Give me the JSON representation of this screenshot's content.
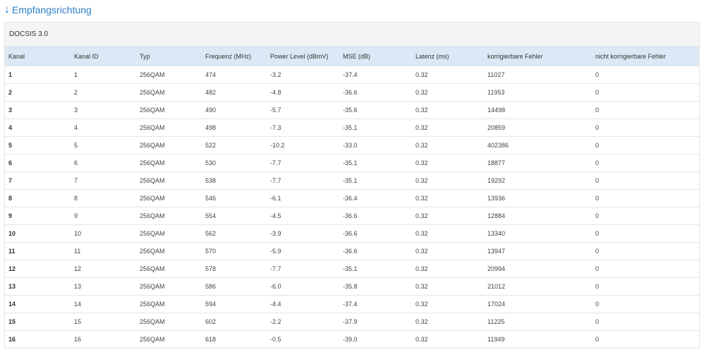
{
  "section": {
    "arrow": "↓",
    "title": "Empfangsrichtung"
  },
  "panel": {
    "title": "DOCSIS 3.0"
  },
  "table": {
    "headers": [
      "Kanal",
      "Kanal ID",
      "Typ",
      "Frequenz (MHz)",
      "Power Level (dBmV)",
      "MSE (dB)",
      "Latenz (ms)",
      "korrigierbare Fehler",
      "nicht korrigierbare Fehler"
    ],
    "rows": [
      [
        "1",
        "1",
        "256QAM",
        "474",
        "-3.2",
        "-37.4",
        "0.32",
        "11027",
        "0"
      ],
      [
        "2",
        "2",
        "256QAM",
        "482",
        "-4.8",
        "-36.6",
        "0.32",
        "11953",
        "0"
      ],
      [
        "3",
        "3",
        "256QAM",
        "490",
        "-5.7",
        "-35.6",
        "0.32",
        "14498",
        "0"
      ],
      [
        "4",
        "4",
        "256QAM",
        "498",
        "-7.3",
        "-35.1",
        "0.32",
        "20859",
        "0"
      ],
      [
        "5",
        "5",
        "256QAM",
        "522",
        "-10.2",
        "-33.0",
        "0.32",
        "402386",
        "0"
      ],
      [
        "6",
        "6",
        "256QAM",
        "530",
        "-7.7",
        "-35.1",
        "0.32",
        "18877",
        "0"
      ],
      [
        "7",
        "7",
        "256QAM",
        "538",
        "-7.7",
        "-35.1",
        "0.32",
        "19292",
        "0"
      ],
      [
        "8",
        "8",
        "256QAM",
        "546",
        "-6.1",
        "-36.4",
        "0.32",
        "13936",
        "0"
      ],
      [
        "9",
        "9",
        "256QAM",
        "554",
        "-4.5",
        "-36.6",
        "0.32",
        "12884",
        "0"
      ],
      [
        "10",
        "10",
        "256QAM",
        "562",
        "-3.9",
        "-36.6",
        "0.32",
        "13340",
        "0"
      ],
      [
        "11",
        "11",
        "256QAM",
        "570",
        "-5.9",
        "-36.6",
        "0.32",
        "13947",
        "0"
      ],
      [
        "12",
        "12",
        "256QAM",
        "578",
        "-7.7",
        "-35.1",
        "0.32",
        "20994",
        "0"
      ],
      [
        "13",
        "13",
        "256QAM",
        "586",
        "-6.0",
        "-35.8",
        "0.32",
        "21012",
        "0"
      ],
      [
        "14",
        "14",
        "256QAM",
        "594",
        "-4.4",
        "-37.4",
        "0.32",
        "17024",
        "0"
      ],
      [
        "15",
        "15",
        "256QAM",
        "602",
        "-2.2",
        "-37.9",
        "0.32",
        "11225",
        "0"
      ],
      [
        "16",
        "16",
        "256QAM",
        "618",
        "-0.5",
        "-39.0",
        "0.32",
        "11949",
        "0"
      ]
    ]
  },
  "colors": {
    "link": "#2f80c8",
    "header_bg": "#dbe9f6",
    "title_bg": "#f4f4f4"
  }
}
